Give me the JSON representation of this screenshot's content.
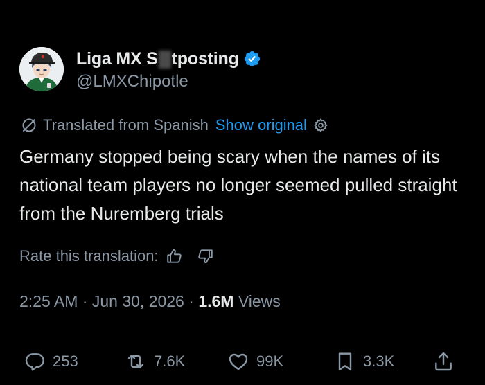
{
  "author": {
    "display_name_prefix": "Liga MX S",
    "display_name_suffix": "tposting",
    "handle": "@LMXChipotle",
    "verified": true,
    "verified_color": "#1d9bf0"
  },
  "translation": {
    "label": "Translated from Spanish",
    "show_original": "Show original",
    "icon": "globe-slash-icon",
    "settings_icon": "gear-icon"
  },
  "tweet": {
    "text": "Germany stopped being scary when the names of its national team players no longer seemed pulled straight from the Nuremberg trials"
  },
  "rate": {
    "label": "Rate this translation:",
    "up_icon": "thumbs-up-icon",
    "down_icon": "thumbs-down-icon"
  },
  "meta": {
    "time": "2:25 AM",
    "separator": "·",
    "date": "Jun 30, 2026",
    "views_count": "1.6M",
    "views_label": "Views"
  },
  "actions": {
    "replies": "253",
    "retweets": "7.6K",
    "likes": "99K",
    "bookmarks": "3.3K"
  },
  "colors": {
    "background": "#000000",
    "primary_text": "#e7e9ea",
    "secondary_text": "#8b98a5",
    "accent": "#1d9bf0"
  }
}
